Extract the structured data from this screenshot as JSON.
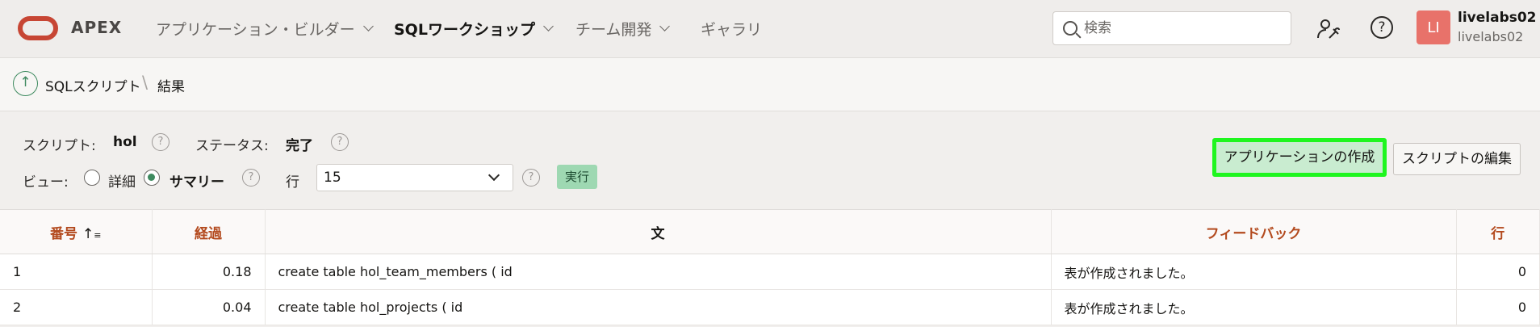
{
  "header": {
    "brand": "APEX",
    "nav": [
      {
        "label": "アプリケーション・ビルダー",
        "has_menu": true
      },
      {
        "label": "SQLワークショップ",
        "has_menu": true,
        "active": true
      },
      {
        "label": "チーム開発",
        "has_menu": true
      },
      {
        "label": "ギャラリ",
        "has_menu": false
      }
    ],
    "search_placeholder": "検索",
    "user_name": "livelabs02",
    "user_workspace": "livelabs02",
    "avatar_initials": "LI"
  },
  "breadcrumb": {
    "parent": "SQLスクリプト",
    "current": "結果"
  },
  "info": {
    "script_label": "スクリプト:",
    "script_value": "hol",
    "status_label": "ステータス:",
    "status_value": "完了",
    "view_label": "ビュー:",
    "view_detail": "詳細",
    "view_summary": "サマリー",
    "view_selected": "サマリー",
    "rows_label": "行",
    "rows_value": "15",
    "run_label": "実行",
    "help_glyph": "?"
  },
  "actions": {
    "create_app": "アプリケーションの作成",
    "edit_script": "スクリプトの編集"
  },
  "table": {
    "columns": [
      "番号",
      "経過",
      "文",
      "フィードバック",
      "行"
    ],
    "sort_indicator": "↑",
    "rows": [
      {
        "no": "1",
        "elapsed": "0.18",
        "statement": "create table hol_team_members ( id",
        "feedback": "表が作成されました。",
        "rows": "0"
      },
      {
        "no": "2",
        "elapsed": "0.04",
        "statement": "create table hol_projects ( id",
        "feedback": "表が作成されました。",
        "rows": "0"
      }
    ]
  },
  "colors": {
    "accent_red": "#c74634",
    "accent_green": "#3e8a5f",
    "header_link": "#b34a1e",
    "highlight": "#1ff61f"
  }
}
